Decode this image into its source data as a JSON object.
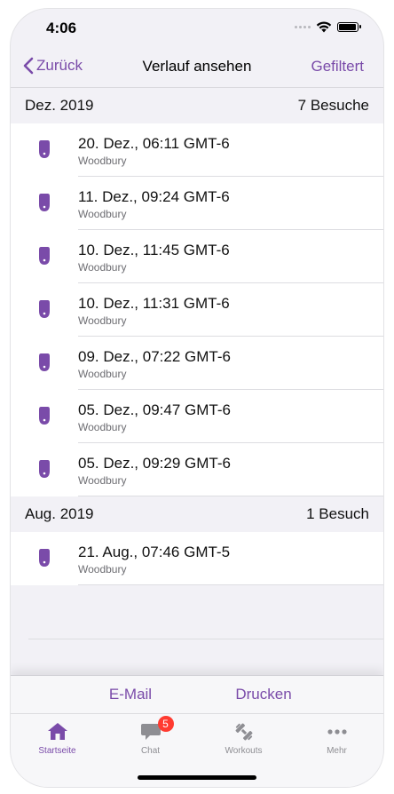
{
  "status": {
    "time": "4:06"
  },
  "nav": {
    "back_label": "Zurück",
    "title": "Verlauf ansehen",
    "right_label": "Gefiltert"
  },
  "sections": [
    {
      "month": "Dez. 2019",
      "count": "7 Besuche",
      "items": [
        {
          "title": "20. Dez., 06:11 GMT-6",
          "subtitle": "Woodbury"
        },
        {
          "title": "11. Dez., 09:24 GMT-6",
          "subtitle": "Woodbury"
        },
        {
          "title": "10. Dez., 11:45 GMT-6",
          "subtitle": "Woodbury"
        },
        {
          "title": "10. Dez., 11:31 GMT-6",
          "subtitle": "Woodbury"
        },
        {
          "title": "09. Dez., 07:22 GMT-6",
          "subtitle": "Woodbury"
        },
        {
          "title": "05. Dez., 09:47 GMT-6",
          "subtitle": "Woodbury"
        },
        {
          "title": "05. Dez., 09:29 GMT-6",
          "subtitle": "Woodbury"
        }
      ]
    },
    {
      "month": "Aug. 2019",
      "count": "1 Besuch",
      "items": [
        {
          "title": "21. Aug., 07:46 GMT-5",
          "subtitle": "Woodbury"
        }
      ]
    }
  ],
  "actions": {
    "email_label": "E-Mail",
    "print_label": "Drucken"
  },
  "tabs": [
    {
      "label": "Startseite",
      "icon": "home-icon",
      "active": true
    },
    {
      "label": "Chat",
      "icon": "chat-icon",
      "badge": "5"
    },
    {
      "label": "Workouts",
      "icon": "dumbbell-icon"
    },
    {
      "label": "Mehr",
      "icon": "more-icon"
    }
  ],
  "colors": {
    "accent": "#7a4ba9",
    "badge": "#ff3b30"
  }
}
